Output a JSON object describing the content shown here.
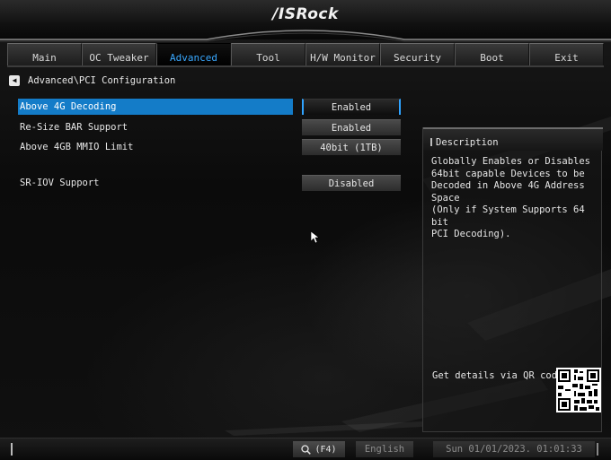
{
  "brand": "/ISRock",
  "tabs": [
    {
      "label": "Main",
      "active": false
    },
    {
      "label": "OC Tweaker",
      "active": false
    },
    {
      "label": "Advanced",
      "active": true
    },
    {
      "label": "Tool",
      "active": false
    },
    {
      "label": "H/W Monitor",
      "active": false
    },
    {
      "label": "Security",
      "active": false
    },
    {
      "label": "Boot",
      "active": false
    },
    {
      "label": "Exit",
      "active": false
    }
  ],
  "breadcrumb": "Advanced\\PCI Configuration",
  "settings": [
    {
      "label": "Above 4G Decoding",
      "value": "Enabled",
      "selected": true
    },
    {
      "label": "Re-Size BAR Support",
      "value": "Enabled",
      "selected": false
    },
    {
      "label": "Above 4GB MMIO Limit",
      "value": "40bit (1TB)",
      "selected": false
    },
    {
      "label": "SR-IOV Support",
      "value": "Disabled",
      "selected": false
    }
  ],
  "description": {
    "title": "Description",
    "text": "Globally Enables or Disables\n64bit capable Devices to be\nDecoded in Above 4G Address Space\n(Only if System Supports 64 bit\nPCI Decoding).",
    "qr_label": "Get details via QR code"
  },
  "footer": {
    "search_label": "(F4)",
    "language": "English",
    "datetime": "Sun 01/01/2023. 01:01:33"
  },
  "colors": {
    "accent": "#147cc8",
    "active_tab_text": "#39a8ff",
    "background": "#0b0b0b",
    "muted_text": "#8b8b8b"
  },
  "icons": {
    "back": "chevron-left-icon",
    "search": "search-icon",
    "cursor": "mouse-pointer-icon",
    "qr": "qr-code-icon"
  }
}
